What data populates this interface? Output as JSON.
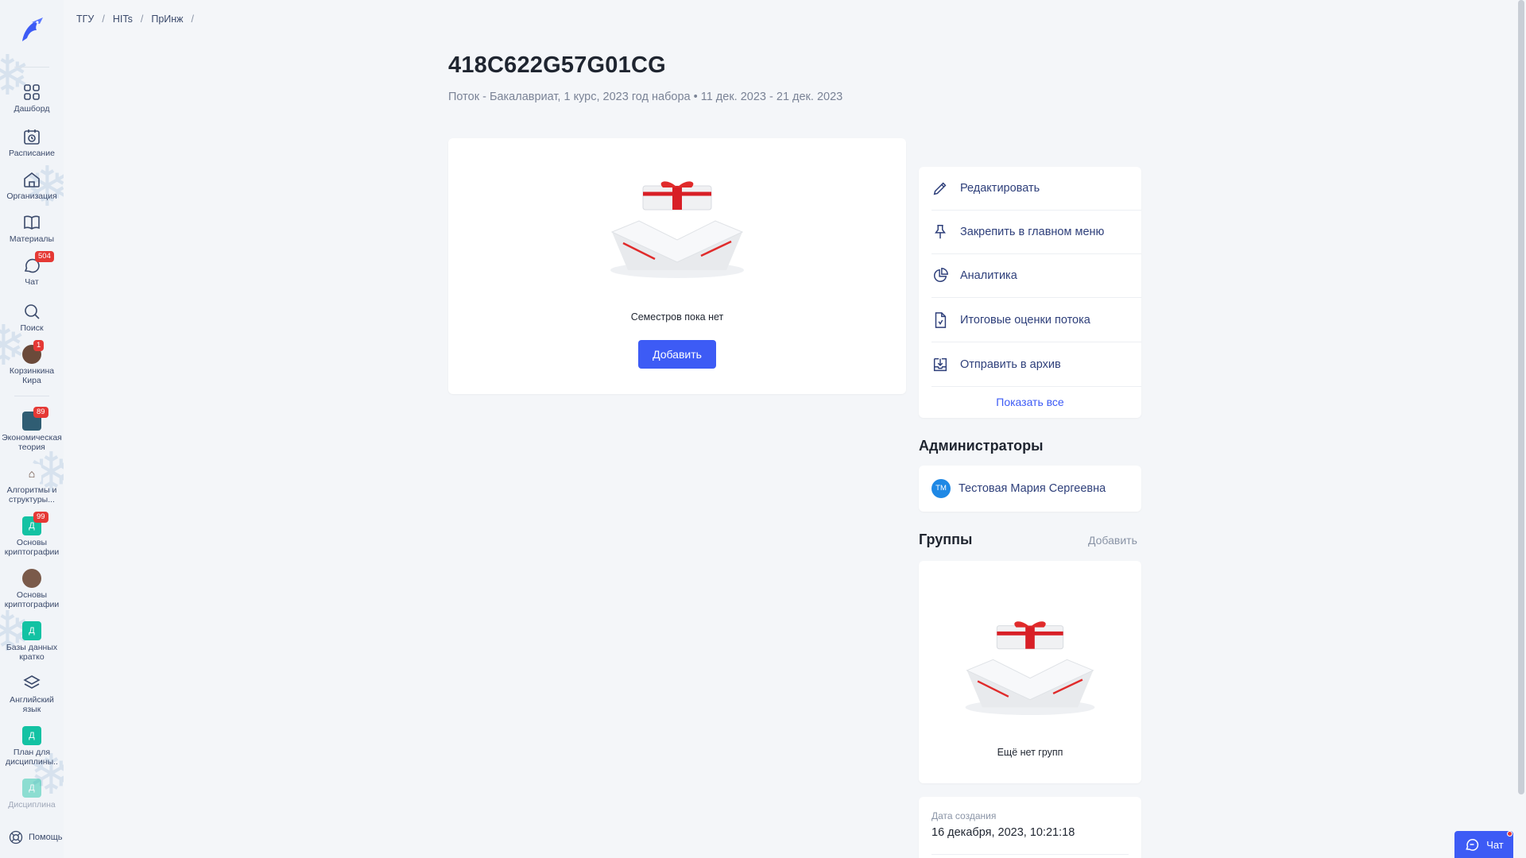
{
  "sidebar": {
    "items": [
      {
        "label": "Дашборд",
        "icon": "grid-icon"
      },
      {
        "label": "Расписание",
        "icon": "calendar-clock-icon"
      },
      {
        "label": "Организация",
        "icon": "house-icon"
      },
      {
        "label": "Материалы",
        "icon": "book-icon"
      },
      {
        "label": "Чат",
        "icon": "chat-icon",
        "badge": "504"
      },
      {
        "label": "Поиск",
        "icon": "search-icon"
      }
    ],
    "user": {
      "label": "Корзинкина Кира",
      "badge": "1"
    },
    "courses": [
      {
        "label": "Экономическая теория",
        "badge": "89"
      },
      {
        "label": "Алгоритмы и структуры..."
      },
      {
        "label": "Основы криптографии",
        "badge": "99",
        "initial": "Д"
      },
      {
        "label": "Основы криптографии"
      },
      {
        "label": "Базы данных кратко",
        "initial": "Д"
      },
      {
        "label": "Английский язык"
      },
      {
        "label": "План для дисциплины..",
        "initial": "Д"
      },
      {
        "label": "Дисциплина",
        "initial": "Д"
      }
    ],
    "help_label": "Помощь"
  },
  "breadcrumb": [
    "ТГУ",
    "HITs",
    "ПрИнж"
  ],
  "breadcrumb_sep": "/",
  "header": {
    "title": "418C622G57G01CG",
    "subtitle": "Поток - Бакалавриат, 1 курс, 2023 год набора • 11 дек. 2023 - 21 дек. 2023"
  },
  "semesters": {
    "empty_text": "Семестров пока нет",
    "add_label": "Добавить"
  },
  "actions": {
    "items": [
      {
        "label": "Редактировать",
        "icon": "pencil-icon"
      },
      {
        "label": "Закрепить в главном меню",
        "icon": "pin-icon"
      },
      {
        "label": "Аналитика",
        "icon": "pie-chart-icon"
      },
      {
        "label": "Итоговые оценки потока",
        "icon": "document-icon"
      },
      {
        "label": "Отправить в архив",
        "icon": "archive-icon"
      }
    ],
    "show_all": "Показать все"
  },
  "admins": {
    "title": "Администраторы",
    "items": [
      {
        "initials": "ТМ",
        "name": "Тестовая Мария Сергеевна"
      }
    ]
  },
  "groups": {
    "title": "Группы",
    "add_label": "Добавить",
    "empty_text": "Ещё нет групп"
  },
  "meta": {
    "created_label": "Дата создания",
    "created_value": "16 декабря, 2023, 10:21:18"
  },
  "chat_widget": {
    "label": "Чат"
  },
  "colors": {
    "accent": "#3d5bf5",
    "badge": "#e53935",
    "link": "#2e3f7a",
    "teal": "#13c2a3"
  }
}
